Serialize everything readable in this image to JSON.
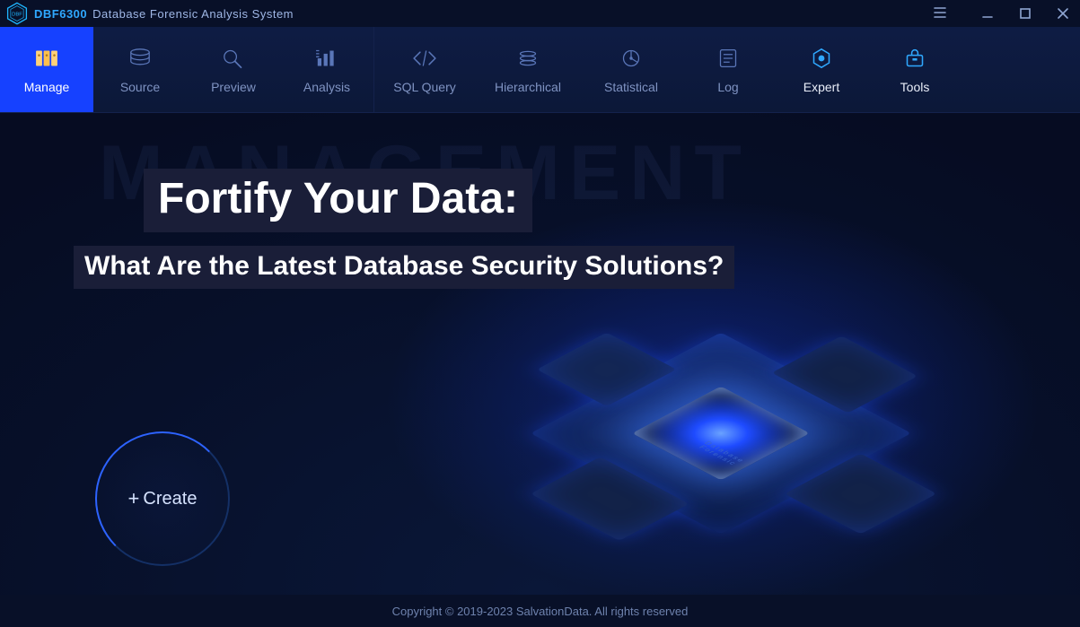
{
  "titlebar": {
    "product_code": "DBF6300",
    "product_name": "Database Forensic Analysis System",
    "logo_label": "DBF"
  },
  "toolbar": {
    "left": [
      {
        "key": "manage",
        "label": "Manage",
        "active": true
      },
      {
        "key": "source",
        "label": "Source",
        "active": false
      },
      {
        "key": "preview",
        "label": "Preview",
        "active": false
      },
      {
        "key": "analysis",
        "label": "Analysis",
        "active": false
      }
    ],
    "right": [
      {
        "key": "sqlquery",
        "label": "SQL Query"
      },
      {
        "key": "hierarchical",
        "label": "Hierarchical"
      },
      {
        "key": "statistical",
        "label": "Statistical"
      },
      {
        "key": "log",
        "label": "Log"
      },
      {
        "key": "expert",
        "label": "Expert",
        "bright": true
      },
      {
        "key": "tools",
        "label": "Tools",
        "bright": true
      }
    ]
  },
  "main": {
    "bg_word": "MANAGEMENT",
    "headline1": "Fortify Your Data:",
    "headline2": "What Are the Latest Database Security Solutions?",
    "scene_label_top": "Database",
    "scene_label_bottom": "Forensic",
    "create_label": "Create"
  },
  "footer": {
    "copyright": "Copyright © 2019-2023  SalvationData. All rights reserved"
  }
}
